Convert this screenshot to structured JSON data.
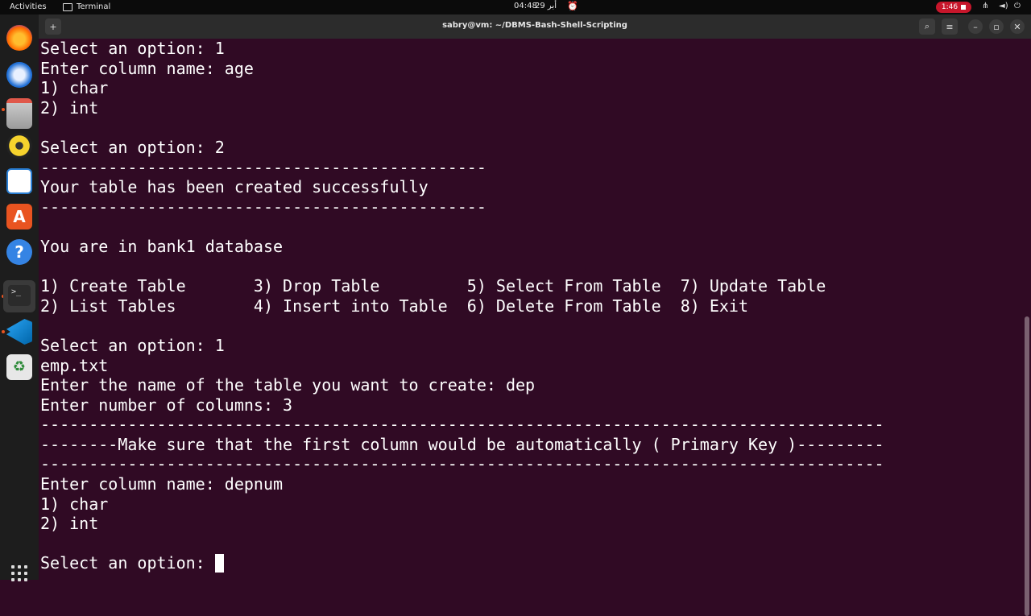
{
  "topbar": {
    "activities": "Activities",
    "app_name": "Terminal",
    "time": "04:48",
    "date": "29 أبر",
    "recording_time": "1:46",
    "icons": [
      "alarm-icon",
      "network-icon",
      "volume-icon",
      "power-icon"
    ]
  },
  "dock": {
    "items": [
      "firefox-icon",
      "thunderbird-icon",
      "files-icon",
      "rhythmbox-icon",
      "libreoffice-writer-icon",
      "app-center-icon",
      "help-icon",
      "terminal-icon",
      "vscode-icon",
      "trash-icon"
    ],
    "show_apps": "show-apps-icon"
  },
  "window": {
    "title": "sabry@vm: ~/DBMS-Bash-Shell-Scripting",
    "buttons": {
      "new_tab": "+",
      "search": "⌕",
      "menu": "≡",
      "minimize": "–",
      "maximize": "▫",
      "close": "✕"
    }
  },
  "terminal": {
    "lines": [
      "Select an option: 1",
      "Enter column name: age",
      "1) char",
      "2) int",
      "",
      "Select an option: 2",
      "----------------------------------------------",
      "Your table has been created successfully",
      "----------------------------------------------",
      "",
      "You are in bank1 database",
      "",
      "1) Create Table       3) Drop Table         5) Select From Table  7) Update Table",
      "2) List Tables        4) Insert into Table  6) Delete From Table  8) Exit",
      "",
      "Select an option: 1",
      "emp.txt",
      "Enter the name of the table you want to create: dep",
      "Enter number of columns: 3",
      "---------------------------------------------------------------------------------------",
      "--------Make sure that the first column would be automatically ( Primary Key )---------",
      "---------------------------------------------------------------------------------------",
      "Enter column name: depnum",
      "1) char",
      "2) int",
      ""
    ],
    "prompt": "Select an option: "
  },
  "colors": {
    "terminal_bg": "#300a24",
    "headerbar_bg": "#2c2c2c",
    "dock_bg": "#1d1d1d",
    "accent": "#e95420",
    "record": "#c7162b"
  }
}
